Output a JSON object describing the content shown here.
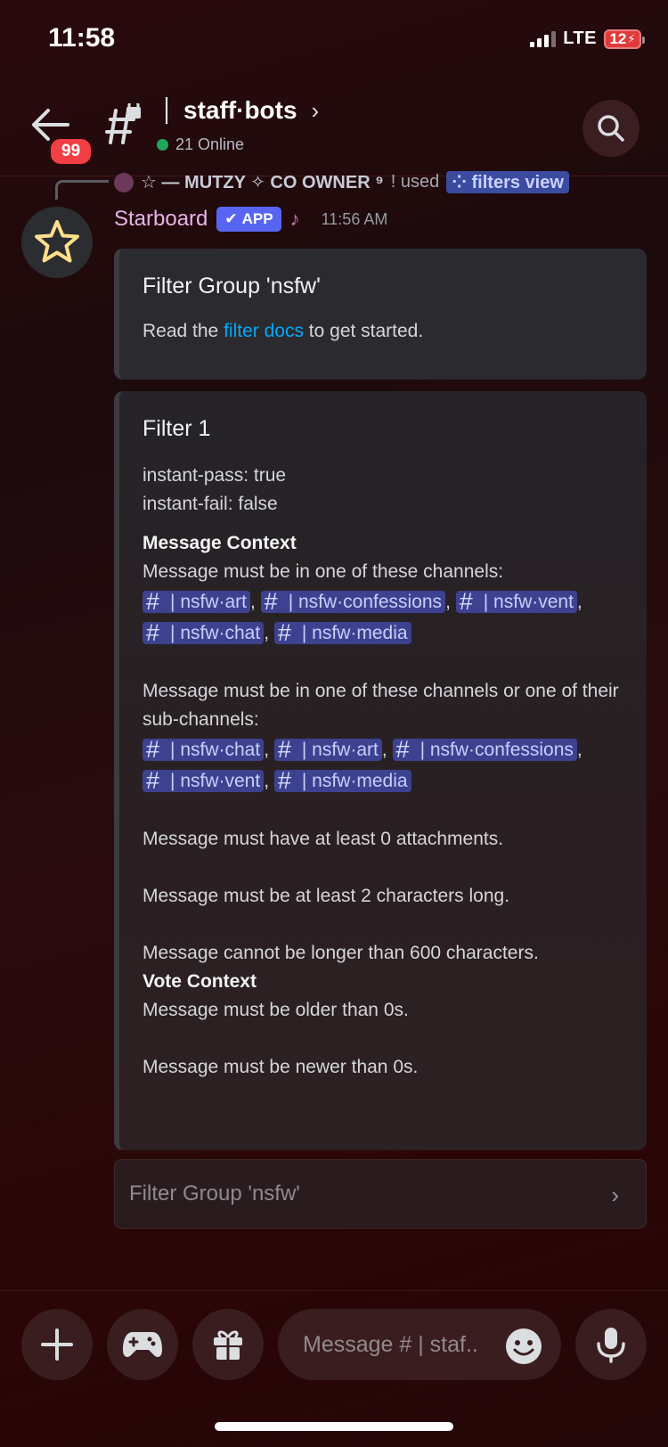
{
  "status": {
    "time": "11:58",
    "network": "LTE",
    "battery": "12"
  },
  "header": {
    "badge": "99",
    "channel_name": "staff·bots",
    "online": "21 Online"
  },
  "reply": {
    "name": "☆ — MUTZY ✧ CO OWNER ⁹",
    "used": "! used",
    "command": "filters view"
  },
  "message": {
    "author": "Starboard",
    "app_badge": "APP",
    "timestamp": "11:56 AM"
  },
  "embed1": {
    "title": "Filter Group 'nsfw'",
    "line_prefix": "Read the ",
    "link": "filter docs",
    "line_suffix": " to get started."
  },
  "embed2": {
    "title": "Filter 1",
    "instant_pass": "instant-pass: true",
    "instant_fail": "instant-fail: false",
    "message_context": "Message Context",
    "channels_label": "Message must be in one of these channels:",
    "channels": [
      "| nsfw·art",
      "| nsfw·confessions",
      "| nsfw·vent",
      "| nsfw·chat",
      "| nsfw·media"
    ],
    "subchannels_label": "Message must be in one of these channels or one of their sub-channels:",
    "subchannels": [
      "| nsfw·chat",
      "| nsfw·art",
      "| nsfw·confessions",
      "| nsfw·vent",
      "| nsfw·media"
    ],
    "attachments": "Message must have at least 0 attachments.",
    "min_length": "Message must be at least 2 characters long.",
    "max_length": "Message cannot be longer than 600 characters.",
    "vote_context": "Vote Context",
    "older": "Message must be older than 0s.",
    "newer": "Message must be newer than 0s."
  },
  "select": {
    "label": "Filter Group 'nsfw'"
  },
  "composer": {
    "placeholder": "Message # | staf.."
  },
  "colors": {
    "accent": "#5865f2",
    "link": "#00a8fc",
    "online": "#23a559",
    "badge": "#f23f43"
  }
}
